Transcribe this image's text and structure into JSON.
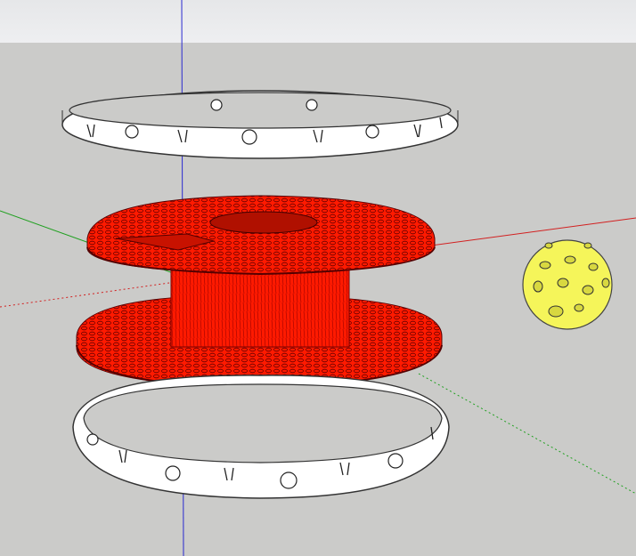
{
  "colors": {
    "sky": "#eceef0",
    "ground": "#cbcbc9",
    "axis_red": "#d22020",
    "axis_green": "#20a020",
    "axis_blue": "#2020c8",
    "spool": "#ff1a00",
    "ring": "#ffffff",
    "ball": "#f5f55a"
  }
}
